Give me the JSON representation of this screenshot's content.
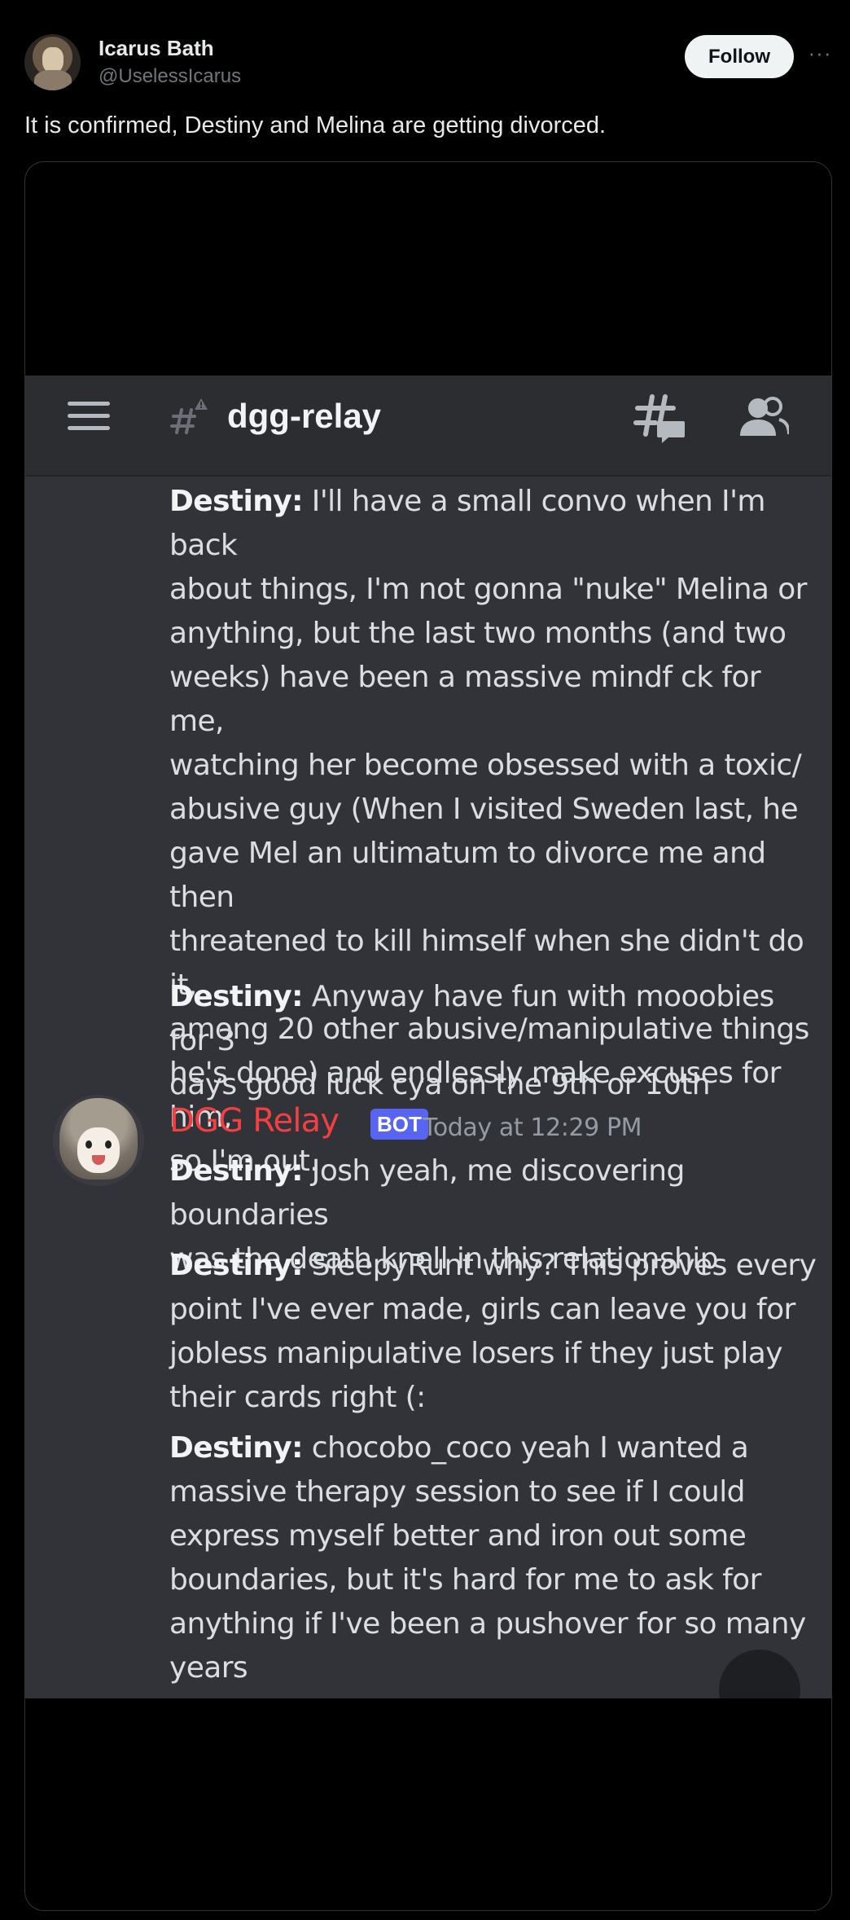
{
  "tweet": {
    "author_name": "Icarus Bath",
    "author_handle": "@UselessIcarus",
    "follow_label": "Follow",
    "more_icon": "more-icon",
    "text": "It is confirmed, Destiny and Melina are getting divorced."
  },
  "discord": {
    "channel_name": "dgg-relay",
    "icons": [
      "hamburger-menu-icon",
      "channel-hash-icon",
      "threads-icon",
      "members-icon"
    ],
    "bot_author": "DGG Relay",
    "bot_tag": "BOT",
    "timestamp": "Today at 12:29 PM",
    "speaker": "Destiny:",
    "messages": [
      {
        "lines": [
          " I'll have a small convo when I'm back",
          "about things, I'm not gonna \"nuke\" Melina or",
          "anything, but the last two months (and two",
          "weeks) have been a massive mindf  ck for me,",
          "watching her become obsessed with a toxic/",
          "abusive guy (When I visited Sweden last, he",
          "gave Mel an ultimatum to divorce me and then",
          "threatened to kill himself when she didn't do it,",
          "among 20 other abusive/manipulative things",
          "he's done) and endlessly make excuses for him,",
          "so I'm out."
        ]
      },
      {
        "lines": [
          " Anyway have fun with mooobies for 3",
          "days good luck cya on the 9th or 10th"
        ]
      },
      {
        "lines": [
          " Josh yeah, me discovering boundaries",
          "was the death knell in this relationship"
        ]
      },
      {
        "lines": [
          " SleepyRunt why? This proves every",
          "point I've ever made, girls can leave you for",
          "jobless manipulative losers if they just play",
          "their cards right (:"
        ]
      },
      {
        "lines": [
          " chocobo_coco yeah I wanted a",
          "massive therapy session to see if I could",
          "express myself better and iron out some",
          "boundaries, but it's hard for me to ask for",
          "anything if I've been a pushover for so many",
          "years"
        ]
      }
    ]
  }
}
